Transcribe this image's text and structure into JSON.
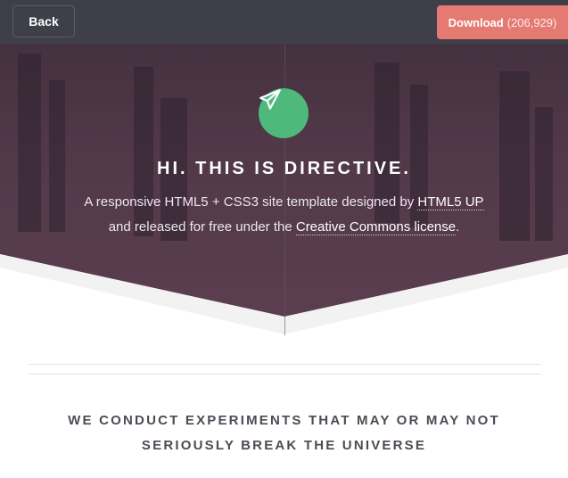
{
  "topbar": {
    "back_label": "Back",
    "download_label": "Download",
    "download_count": "(206,929)"
  },
  "hero": {
    "icon": "paper-plane-icon",
    "title": "HI. THIS IS DIRECTIVE.",
    "text_line1_prefix": "A responsive HTML5 + CSS3 site template designed by ",
    "text_line1_link": "HTML5 UP",
    "text_line2_prefix": "and released for free under the ",
    "text_line2_link": "Creative Commons license",
    "text_line2_suffix": "."
  },
  "section": {
    "heading_line1": "WE CONDUCT EXPERIMENTS THAT MAY OR MAY NOT",
    "heading_line2": "SERIOUSLY BREAK THE UNIVERSE"
  },
  "colors": {
    "topbar": "#3e3f48",
    "download": "#e57a72",
    "icon_circle": "#4fb97c",
    "hero_bg": "#4a3645"
  }
}
